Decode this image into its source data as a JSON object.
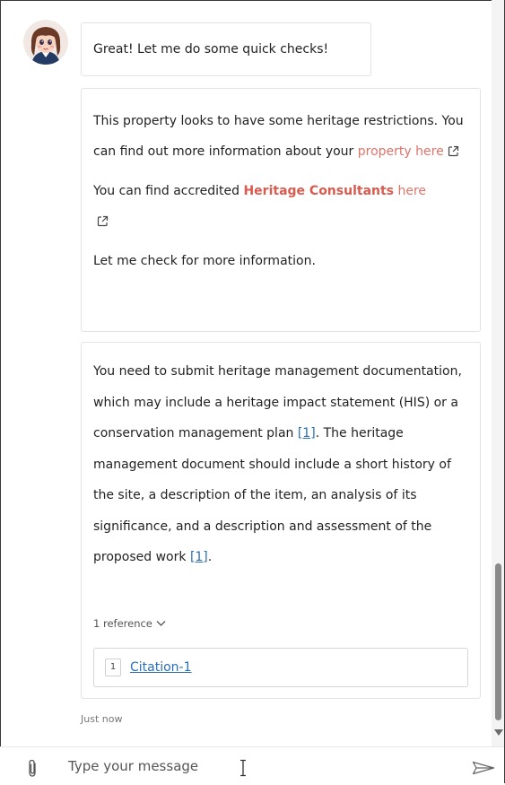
{
  "messages": {
    "greeting": "Great! Let me do some quick checks!",
    "heritage": {
      "line1": "This property looks to have some heritage restrictions. You can find out more information about your ",
      "property_link": "property here",
      "line2_prefix": "You can find accredited ",
      "consultants_link": "Heritage Consultants",
      "line2_here": " here",
      "line3": "Let me check for more information."
    },
    "answer": {
      "part1": "You need to submit heritage management documentation, which may include a heritage impact statement (HIS) or a conservation management plan ",
      "cite1": "[1]",
      "part2": ". The heritage management document should include a short history of the site, a description of the item, an analysis of its significance, and a description and assessment of the proposed work ",
      "cite2": "[1]",
      "part3": "."
    },
    "references_toggle": "1 reference",
    "reference": {
      "number": "1",
      "label": "Citation-1"
    },
    "timestamp": "Just now"
  },
  "composer": {
    "placeholder": "Type your message"
  },
  "icons": {
    "attach": "paperclip-icon",
    "send": "send-icon",
    "external": "external-link-icon",
    "chevron": "chevron-down-icon"
  }
}
